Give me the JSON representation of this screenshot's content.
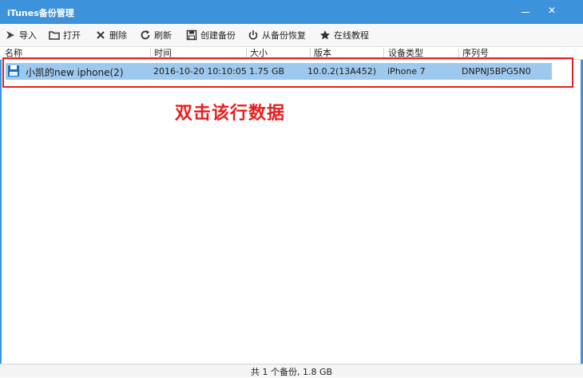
{
  "window": {
    "title": "iTunes备份管理"
  },
  "toolbar": {
    "items": [
      {
        "label": "导入",
        "icon": "import-icon"
      },
      {
        "label": "打开",
        "icon": "folder-icon"
      },
      {
        "label": "删除",
        "icon": "delete-icon"
      },
      {
        "label": "刷新",
        "icon": "refresh-icon"
      },
      {
        "label": "创建备份",
        "icon": "save-icon"
      },
      {
        "label": "从备份恢复",
        "icon": "power-icon"
      },
      {
        "label": "在线教程",
        "icon": "star-icon"
      }
    ]
  },
  "columns": [
    "名称",
    "时间",
    "大小",
    "版本",
    "设备类型",
    "序列号"
  ],
  "rows": [
    {
      "name": "小凯的new iphone(2)",
      "time": "2016-10-20 10:10:05",
      "size": "1.75 GB",
      "version": "10.0.2(13A452)",
      "device": "iPhone 7",
      "serial": "DNPNJ5BPG5N0",
      "icon": "backup-disk-icon"
    }
  ],
  "annotation": "双击该行数据",
  "status": "共 1 个备份, 1.8 GB",
  "colors": {
    "titlebar": "#3d92dc",
    "selection": "#9ec9ee",
    "highlight": "#e81e1e"
  }
}
